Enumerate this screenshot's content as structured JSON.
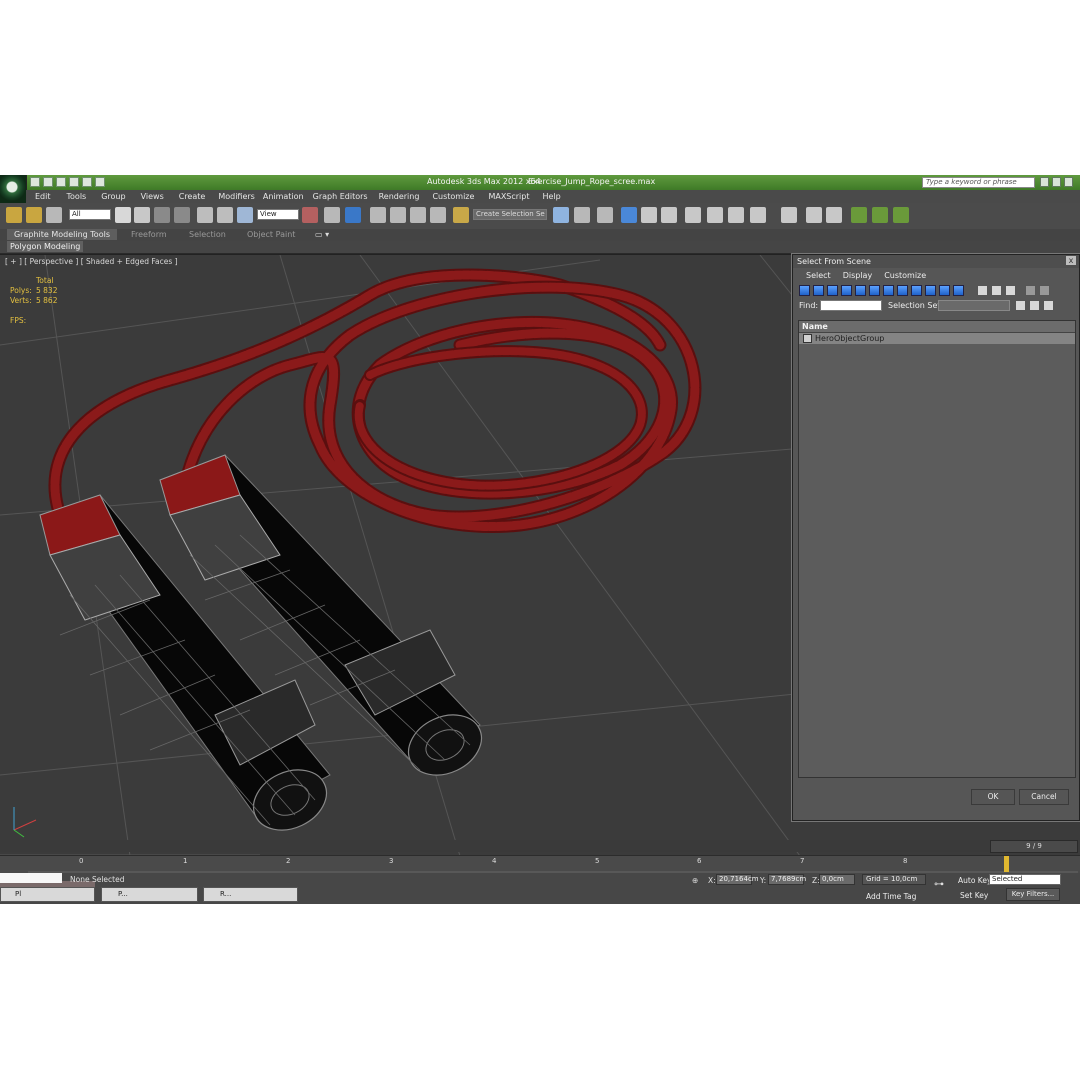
{
  "window": {
    "title": "Autodesk 3ds Max  2012 x64",
    "file": "Exercise_Jump_Rope_scree.max",
    "search_placeholder": "Type a keyword or phrase"
  },
  "menu": [
    "Edit",
    "Tools",
    "Group",
    "Views",
    "Create",
    "Modifiers",
    "Animation",
    "Graph Editors",
    "Rendering",
    "Customize",
    "MAXScript",
    "Help"
  ],
  "toolbar": {
    "filter_value": "All",
    "refcoord_value": "View",
    "selection_set_placeholder": "Create Selection Se"
  },
  "ribbon": {
    "tabs": [
      "Graphite Modeling Tools",
      "Freeform",
      "Selection",
      "Object Paint"
    ],
    "panel": "Polygon Modeling"
  },
  "viewport": {
    "label": "[ + ] [ Perspective ] [ Shaded + Edged Faces ]",
    "stats": {
      "header": "Total",
      "polys_label": "Polys:",
      "polys_value": "5 832",
      "verts_label": "Verts:",
      "verts_value": "5 862",
      "fps_label": "FPS:"
    },
    "colors": {
      "rope": "#8b1a1a",
      "handle": "#0a0a0a",
      "wire": "#9a9a9a",
      "grid": "#6a6a6a"
    }
  },
  "dialog": {
    "title": "Select From Scene",
    "close": "x",
    "menu": [
      "Select",
      "Display",
      "Customize"
    ],
    "find_label": "Find:",
    "selset_label": "Selection Set:",
    "column_name": "Name",
    "rows": [
      "HeroObjectGroup"
    ],
    "ok": "OK",
    "cancel": "Cancel"
  },
  "timeline": {
    "frame_counter": "9 / 9",
    "ticks": [
      "0",
      "1",
      "2",
      "3",
      "4",
      "5",
      "6",
      "7",
      "8"
    ]
  },
  "status": {
    "selection": "None Selected",
    "x_label": "X:",
    "x_value": "20,7164cm",
    "y_label": "Y:",
    "y_value": "7,7689cm",
    "z_label": "Z:",
    "z_value": "0,0cm",
    "grid": "Grid = 10,0cm",
    "add_time_tag": "Add Time Tag",
    "auto_key": "Auto Key",
    "set_key": "Set Key",
    "selected": "Selected",
    "key_filters": "Key Filters..."
  },
  "taskbar": [
    {
      "label": "Pl"
    },
    {
      "label": "P..."
    },
    {
      "label": "R..."
    }
  ]
}
